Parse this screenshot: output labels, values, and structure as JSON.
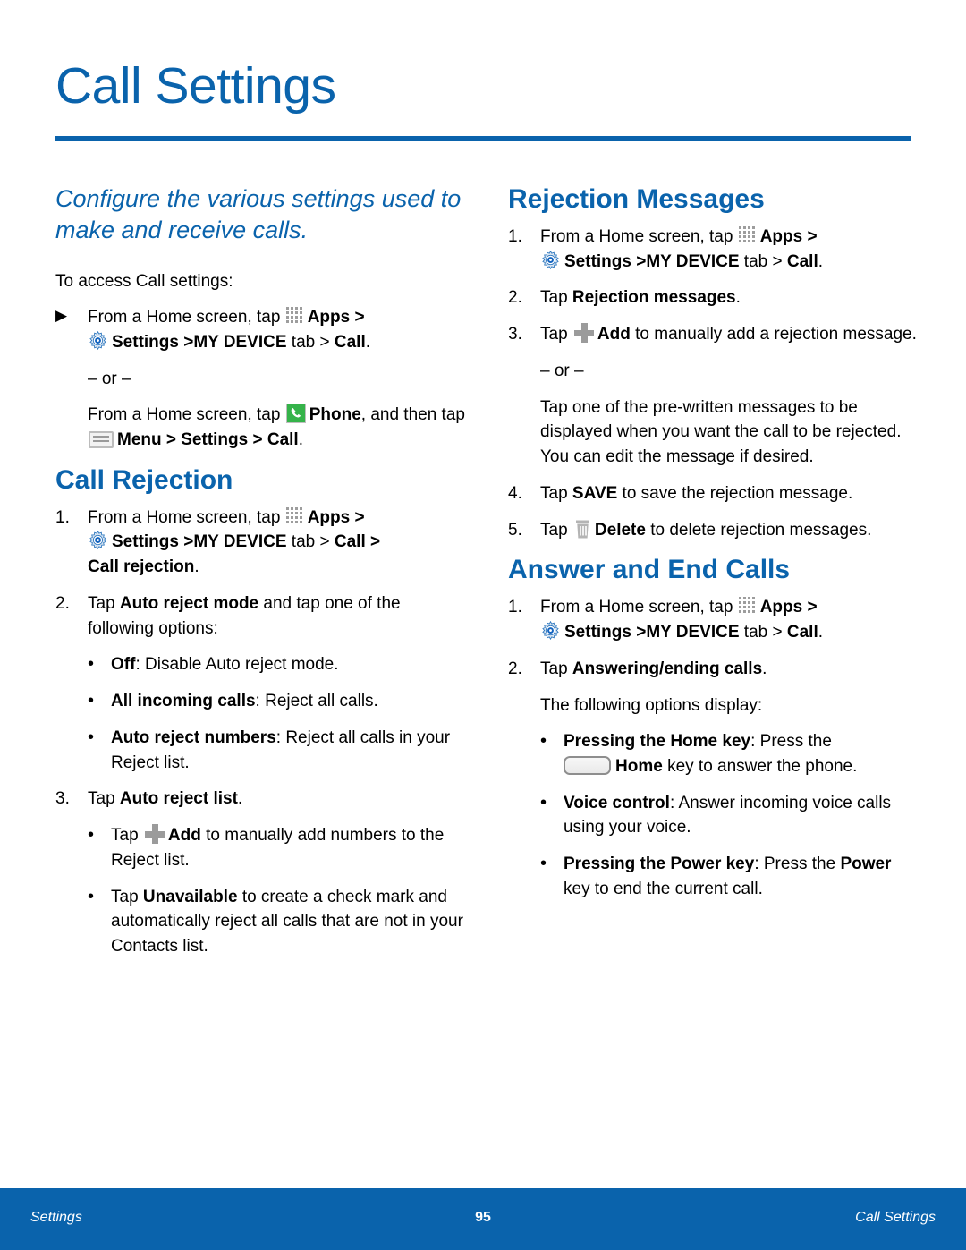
{
  "page": {
    "title": "Call Settings",
    "intro": "Configure the various settings used to make and receive calls."
  },
  "colors": {
    "brand_blue": "#0a63ac",
    "phone_green": "#35b34a",
    "icon_gray": "#9b9b9b"
  },
  "left_column": {
    "lead": "To access Call settings:",
    "access_step_marker": "▶",
    "access_step_a_1": "From a Home screen, tap",
    "access_step_a_apps": "Apps",
    "access_step_a_gt": ">",
    "access_step_a_settings": "Settings >MY DEVICE",
    "access_step_a_tab": "tab >",
    "access_step_a_call": "Call",
    "access_step_a_period": ".",
    "or_label": "– or –",
    "access_step_b_1": "From a Home screen, tap",
    "access_step_b_phone": "Phone",
    "access_step_b_2": ", and then tap",
    "access_step_b_menu": "Menu > Settings > Call",
    "access_step_b_period": ".",
    "call_rejection": {
      "heading": "Call Rejection",
      "step1_num": "1.",
      "step1_a": "From a Home screen, tap",
      "step1_apps": "Apps",
      "step1_gt": ">",
      "step1_settings": "Settings >MY DEVICE",
      "step1_tab": "tab >",
      "step1_call": "Call >",
      "step1_callrejection": "Call rejection",
      "step1_period": ".",
      "step2_num": "2.",
      "step2_a": "Tap",
      "step2_bold": "Auto reject mode",
      "step2_b": "and tap one of the following options:",
      "opt1_bold": "Off",
      "opt1_text": ": Disable Auto reject mode.",
      "opt2_bold": "All incoming calls",
      "opt2_text": ": Reject all calls.",
      "opt3_bold": "Auto reject numbers",
      "opt3_text": ": Reject all calls in your Reject list.",
      "step3_num": "3.",
      "step3_a": "Tap",
      "step3_bold": "Auto reject list",
      "step3_period": ".",
      "sub1_a": "Tap",
      "sub1_bold": "Add",
      "sub1_b": "to manually add numbers to the Reject list.",
      "sub2_a": "Tap",
      "sub2_bold": "Unavailable",
      "sub2_b": "to create a check mark and automatically reject all calls that are not in your Contacts list."
    }
  },
  "right_column": {
    "rejection_messages": {
      "heading": "Rejection Messages",
      "step1_num": "1.",
      "step1_a": "From a Home screen, tap",
      "step1_apps": "Apps",
      "step1_gt": ">",
      "step1_settings": "Settings >MY DEVICE",
      "step1_tab": "tab >",
      "step1_call": "Call",
      "step1_period": ".",
      "step2_num": "2.",
      "step2_a": "Tap",
      "step2_bold": "Rejection messages",
      "step2_period": ".",
      "step3_num": "3.",
      "step3_a": "Tap",
      "step3_bold": "Add",
      "step3_b": "to manually add a rejection message.",
      "or_label": "– or –",
      "or_body": "Tap one of the pre-written messages to be displayed when you want the call to be rejected. You can edit the message if desired.",
      "step4_num": "4.",
      "step4_a": "Tap",
      "step4_bold": "SAVE",
      "step4_b": "to save the rejection message.",
      "step5_num": "5.",
      "step5_a": "Tap",
      "step5_bold": "Delete",
      "step5_b": "to delete rejection messages."
    },
    "answer_end_calls": {
      "heading": "Answer and End Calls",
      "step1_num": "1.",
      "step1_a": "From a Home screen, tap",
      "step1_apps": "Apps",
      "step1_gt": ">",
      "step1_settings": "Settings >MY DEVICE",
      "step1_tab": "tab >",
      "step1_call": "Call",
      "step1_period": ".",
      "step2_num": "2.",
      "step2_a": "Tap",
      "step2_bold": "Answering/ending calls",
      "step2_period": ".",
      "options_lead": "The following options display:",
      "opt1_bold": "Pressing the Home key",
      "opt1_a": ": Press the",
      "opt1_home": "Home",
      "opt1_b": "key to answer the phone.",
      "opt2_bold": "Voice control",
      "opt2_text": ": Answer incoming voice calls using your voice.",
      "opt3_bold": "Pressing the Power key",
      "opt3_a": ": Press the",
      "opt3_power": "Power",
      "opt3_b": "key to end the current call."
    }
  },
  "footer": {
    "left": "Settings",
    "page_number": "95",
    "right": "Call Settings"
  },
  "icons": {
    "apps": "apps-grid-icon",
    "settings": "settings-gear-icon",
    "phone": "phone-icon",
    "menu": "menu-icon",
    "add": "plus-add-icon",
    "delete": "trash-delete-icon",
    "home": "home-key-icon",
    "arrow": "triangle-arrow-bullet"
  }
}
